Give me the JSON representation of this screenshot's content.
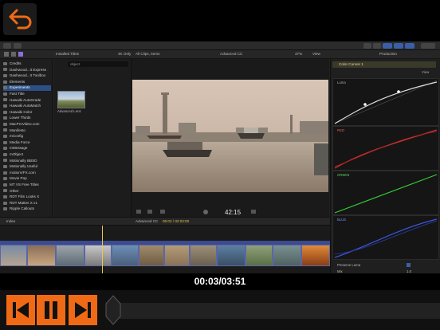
{
  "player": {
    "time_display": "00:03/03:51"
  },
  "icons": {
    "back": "back-arrow-icon",
    "skip_back": "skip-back-icon",
    "pause": "pause-icon",
    "skip_forward": "skip-forward-icon"
  },
  "colors": {
    "accent": "#f06a16",
    "selection": "#2c4f86",
    "timeline_clip": "#5b66a8"
  },
  "browser": {
    "header": "Installed Titles",
    "search_placeholder": "object",
    "filter": "4K Only",
    "count": "All Clips, Items",
    "thumb_label": "Advanced Lens"
  },
  "viewer": {
    "title": "Advanced CC",
    "zoom": "37%",
    "view_label": "View",
    "timecode": "42:15"
  },
  "inspector": {
    "header": "Production",
    "effect": "Color Curves 1",
    "view_label": "View",
    "luma_label": "Luma",
    "red_label": "RED",
    "green_label": "GREEN",
    "blue_label": "BLUE",
    "preserve_label": "Preserve Luma",
    "mix_label": "Mix",
    "mix_value": "1.0"
  },
  "timeline": {
    "index_label": "Index",
    "project": "Advanced CC",
    "project_time": "05:02 / 02:03:00"
  },
  "sidebar": {
    "items": [
      {
        "label": "Credits",
        "selected": false
      },
      {
        "label": "Dashwood...It Express",
        "selected": false
      },
      {
        "label": "Dashwood...It Toolbox",
        "selected": false
      },
      {
        "label": "Elements",
        "selected": false
      },
      {
        "label": "Experiments",
        "selected": true
      },
      {
        "label": "Fast Title",
        "selected": false
      },
      {
        "label": "Hawaiki AutoGrade",
        "selected": false
      },
      {
        "label": "Hawaiki AutoMatch",
        "selected": false
      },
      {
        "label": "Hawaiki Color",
        "selected": false
      },
      {
        "label": "Lower Thirds",
        "selected": false
      },
      {
        "label": "MacProVideo.com",
        "selected": false
      },
      {
        "label": "Manifesto",
        "selected": false
      },
      {
        "label": "mConfig",
        "selected": false
      },
      {
        "label": "Media Force",
        "selected": false
      },
      {
        "label": "mMessage",
        "selected": false
      },
      {
        "label": "mObject",
        "selected": false
      },
      {
        "label": "Motionally BBSD",
        "selected": false
      },
      {
        "label": "Motionally Useful",
        "selected": false
      },
      {
        "label": "motionVFX.com",
        "selected": false
      },
      {
        "label": "Movie Pop",
        "selected": false
      },
      {
        "label": "MT VS Free Titles",
        "selected": false
      },
      {
        "label": "Other",
        "selected": false
      },
      {
        "label": "RDT Film Looks X",
        "selected": false
      },
      {
        "label": "RDT Mattes X v1",
        "selected": false
      },
      {
        "label": "Ripple Callouts",
        "selected": false
      }
    ]
  }
}
